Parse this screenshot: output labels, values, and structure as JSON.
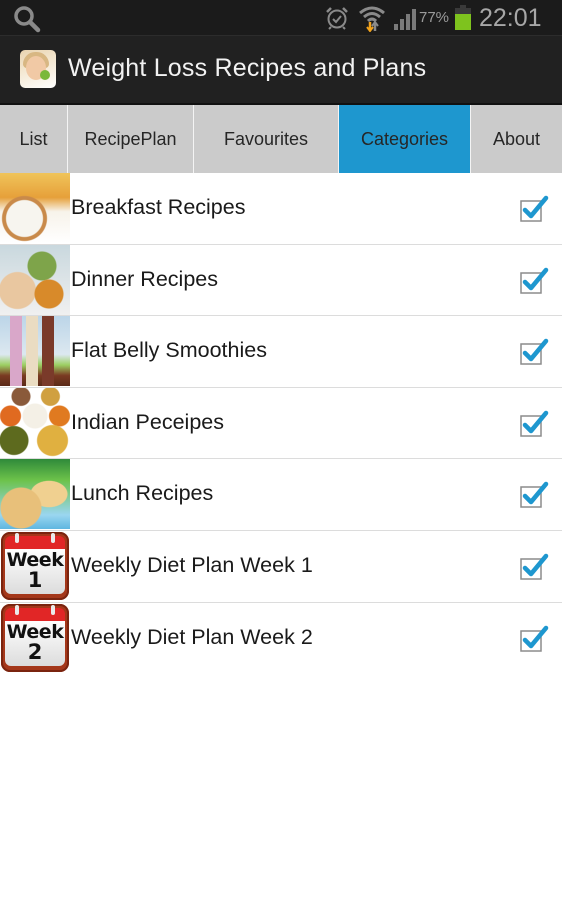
{
  "status_bar": {
    "icons": [
      "search-icon",
      "alarm-icon",
      "wifi-icon",
      "signal-icon",
      "battery-icon"
    ],
    "battery_percent": "77%",
    "time": "22:01",
    "colors": {
      "battery_fill": "#7ec31e",
      "wifi_arrow": "#f2a21a"
    }
  },
  "action_bar": {
    "title": "Weight Loss Recipes and Plans",
    "icon": "app-logo-icon"
  },
  "tabs": [
    {
      "label": "List",
      "active": false
    },
    {
      "label": "RecipePlan",
      "active": false
    },
    {
      "label": "Favourites",
      "active": false
    },
    {
      "label": "Categories",
      "active": true
    },
    {
      "label": "About",
      "active": false
    }
  ],
  "accent_color": "#1e97cf",
  "categories": [
    {
      "label": "Breakfast Recipes",
      "thumb": "breakfast-thumbnail",
      "checked": true
    },
    {
      "label": "Dinner Recipes",
      "thumb": "dinner-thumbnail",
      "checked": true
    },
    {
      "label": "Flat Belly Smoothies",
      "thumb": "smoothies-thumbnail",
      "checked": true
    },
    {
      "label": "Indian Peceipes",
      "thumb": "indian-thumbnail",
      "checked": true
    },
    {
      "label": "Lunch Recipes",
      "thumb": "lunch-thumbnail",
      "checked": true
    },
    {
      "label": "Weekly Diet Plan Week 1",
      "thumb": "calendar-week-icon",
      "calendar_word": "Week",
      "calendar_number": "1",
      "checked": true
    },
    {
      "label": "Weekly Diet Plan Week 2",
      "thumb": "calendar-week-icon",
      "calendar_word": "Week",
      "calendar_number": "2",
      "checked": true
    }
  ]
}
